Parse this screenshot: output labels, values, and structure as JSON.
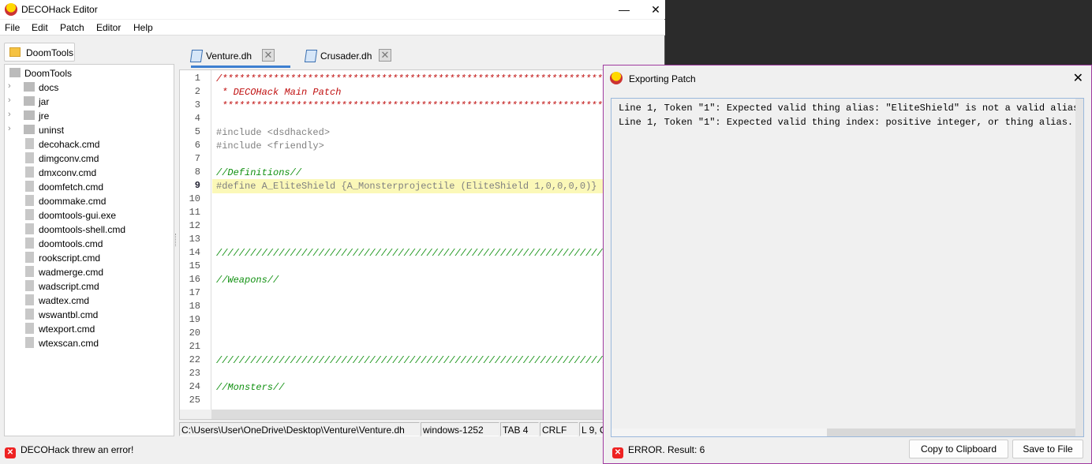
{
  "window": {
    "title": "DECOHack Editor",
    "minimize": "—",
    "close": "✕"
  },
  "menu": [
    "File",
    "Edit",
    "Patch",
    "Editor",
    "Help"
  ],
  "sidebar": {
    "root_button": "DoomTools",
    "tree_root": "DoomTools",
    "folders": [
      "docs",
      "jar",
      "jre",
      "uninst"
    ],
    "files": [
      "decohack.cmd",
      "dimgconv.cmd",
      "dmxconv.cmd",
      "doomfetch.cmd",
      "doommake.cmd",
      "doomtools-gui.exe",
      "doomtools-shell.cmd",
      "doomtools.cmd",
      "rookscript.cmd",
      "wadmerge.cmd",
      "wadscript.cmd",
      "wadtex.cmd",
      "wswantbl.cmd",
      "wtexport.cmd",
      "wtexscan.cmd"
    ]
  },
  "tabs": [
    {
      "label": "Venture.dh",
      "active": true
    },
    {
      "label": "Crusader.dh",
      "active": false
    }
  ],
  "editor": {
    "current_line": 9,
    "lines": [
      {
        "t": "c-block",
        "s": "/**************************************************************************"
      },
      {
        "t": "c-block",
        "s": " * DECOHack Main Patch"
      },
      {
        "t": "c-block",
        "s": " **************************************************************************"
      },
      {
        "t": "",
        "s": ""
      },
      {
        "t": "c-pre",
        "s": "#include <dsdhacked>"
      },
      {
        "t": "c-pre",
        "s": "#include <friendly>"
      },
      {
        "t": "",
        "s": ""
      },
      {
        "t": "c-line",
        "s": "//Definitions//"
      },
      {
        "t": "c-pre",
        "s": "#define A_EliteShield {A_Monsterprojectile (EliteShield 1,0,0,0,0)}"
      },
      {
        "t": "",
        "s": ""
      },
      {
        "t": "",
        "s": ""
      },
      {
        "t": "",
        "s": ""
      },
      {
        "t": "",
        "s": ""
      },
      {
        "t": "c-line",
        "s": "//////////////////////////////////////////////////////////////////////////////"
      },
      {
        "t": "",
        "s": ""
      },
      {
        "t": "c-line",
        "s": "//Weapons//"
      },
      {
        "t": "",
        "s": ""
      },
      {
        "t": "",
        "s": ""
      },
      {
        "t": "",
        "s": ""
      },
      {
        "t": "",
        "s": ""
      },
      {
        "t": "",
        "s": ""
      },
      {
        "t": "c-line",
        "s": "//////////////////////////////////////////////////////////////////////////////"
      },
      {
        "t": "",
        "s": ""
      },
      {
        "t": "c-line",
        "s": "//Monsters//"
      },
      {
        "t": "",
        "s": ""
      }
    ]
  },
  "statusbar": {
    "path": "C:\\Users\\User\\OneDrive\\Desktop\\Venture\\Venture.dh",
    "encoding": "windows-1252",
    "tab": "TAB 4",
    "eol": "CRLF",
    "position": "L 9, C"
  },
  "bottom_status": "DECOHack threw an error!",
  "dialog": {
    "title": "Exporting Patch",
    "close": "✕",
    "messages": [
      "Line 1, Token \"1\": Expected valid thing alias: \"EliteShield\" is not a valid alias.",
      "Line 1, Token \"1\": Expected valid thing index: positive integer, or thing alias."
    ],
    "result": "ERROR. Result: 6",
    "copy_button": "Copy to Clipboard",
    "save_button": "Save to File"
  },
  "icons": {
    "error": "error-x-icon",
    "folder": "folder-icon",
    "file": "file-icon",
    "doc": "document-icon"
  },
  "colors": {
    "accent": "#3d7fd0",
    "dialog_border": "#a03aa0",
    "error": "#e22222",
    "highlight_line": "#fbf8b8"
  }
}
